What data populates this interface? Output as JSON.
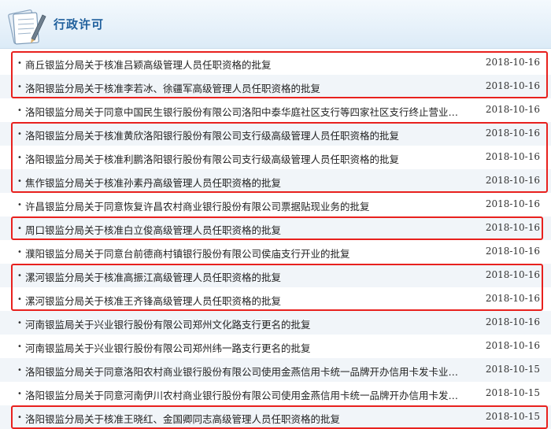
{
  "header": {
    "title": "行政许可",
    "icon": "notepad-pen-icon"
  },
  "items": [
    {
      "title": "商丘银监分局关于核准吕颖高级管理人员任职资格的批复",
      "date": "2018-10-16"
    },
    {
      "title": "洛阳银监分局关于核准李若冰、徐疆军高级管理人员任职资格的批复",
      "date": "2018-10-16"
    },
    {
      "title": "洛阳银监分局关于同意中国民生银行股份有限公司洛阳中泰华庭社区支行等四家社区支行终止营业的…",
      "date": "2018-10-16"
    },
    {
      "title": "洛阳银监分局关于核准黄欣洛阳银行股份有限公司支行级高级管理人员任职资格的批复",
      "date": "2018-10-16"
    },
    {
      "title": "洛阳银监分局关于核准利鹏洛阳银行股份有限公司支行级高级管理人员任职资格的批复",
      "date": "2018-10-16"
    },
    {
      "title": "焦作银监分局关于核准孙素丹高级管理人员任职资格的批复",
      "date": "2018-10-16"
    },
    {
      "title": "许昌银监分局关于同意恢复许昌农村商业银行股份有限公司票据贴现业务的批复",
      "date": "2018-10-16"
    },
    {
      "title": "周口银监分局关于核准白立俊高级管理人员任职资格的批复",
      "date": "2018-10-16"
    },
    {
      "title": "濮阳银监分局关于同意台前德商村镇银行股份有限公司侯庙支行开业的批复",
      "date": "2018-10-16"
    },
    {
      "title": "漯河银监分局关于核准高振江高级管理人员任职资格的批复",
      "date": "2018-10-16"
    },
    {
      "title": "漯河银监分局关于核准王齐锋高级管理人员任职资格的批复",
      "date": "2018-10-16"
    },
    {
      "title": "河南银监局关于兴业银行股份有限公司郑州文化路支行更名的批复",
      "date": "2018-10-16"
    },
    {
      "title": "河南银监局关于兴业银行股份有限公司郑州纬一路支行更名的批复",
      "date": "2018-10-16"
    },
    {
      "title": "洛阳银监分局关于同意洛阳农村商业银行股份有限公司使用金燕信用卡统一品牌开办信用卡发卡业务…",
      "date": "2018-10-15"
    },
    {
      "title": "洛阳银监分局关于同意河南伊川农村商业银行股份有限公司使用金燕信用卡统一品牌开办信用卡发卡…",
      "date": "2018-10-15"
    },
    {
      "title": "洛阳银监分局关于核准王晓红、金国卿同志高级管理人员任职资格的批复",
      "date": "2018-10-15"
    }
  ],
  "colors": {
    "highlight": "#e8211e",
    "title": "#1f5f9c"
  }
}
